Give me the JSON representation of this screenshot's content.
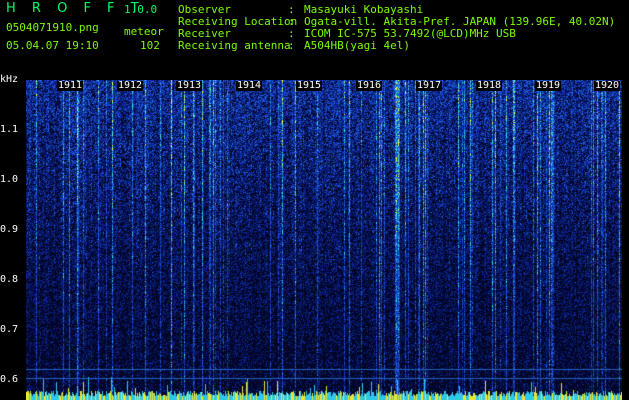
{
  "app": {
    "title": "H R O F F T",
    "version": "1.0.0"
  },
  "file": {
    "name": "0504071910.png",
    "datetime": "05.04.07 19:10",
    "mode_label": "meteor",
    "count": "102"
  },
  "info": [
    {
      "label": "Observer",
      "sep": ":",
      "value": "Masayuki Kobayashi"
    },
    {
      "label": "Receiving Location",
      "sep": ":",
      "value": "Ogata-vill. Akita-Pref. JAPAN (139.96E, 40.02N)"
    },
    {
      "label": "Receiver",
      "sep": ":",
      "value": "ICOM IC-575 53.7492(@LCD)MHz USB"
    },
    {
      "label": "Receiving antenna",
      "sep": ":",
      "value": "A504HB(yagi 4el)"
    }
  ],
  "axis": {
    "unit": "kHz",
    "ticks": [
      "1.1",
      "1.0",
      "0.9",
      "0.8",
      "0.7",
      "0.6"
    ],
    "tick_values": [
      1.1,
      1.0,
      0.9,
      0.8,
      0.7,
      0.6
    ],
    "range": [
      0.57,
      1.17
    ]
  },
  "time_labels": [
    "1911",
    "1912",
    "1913",
    "1914",
    "1915",
    "1916",
    "1917",
    "1918",
    "1919",
    "1920"
  ],
  "colors": {
    "background": "#000000",
    "text_green": "#7CFC00",
    "text_white": "#FFFFFF",
    "spectro_low": "#0a1a6e",
    "spectro_mid": "#1e50d8",
    "spectro_high": "#40e0e0",
    "spectro_peak": "#ffff00",
    "ref_line": "#2060c0"
  }
}
